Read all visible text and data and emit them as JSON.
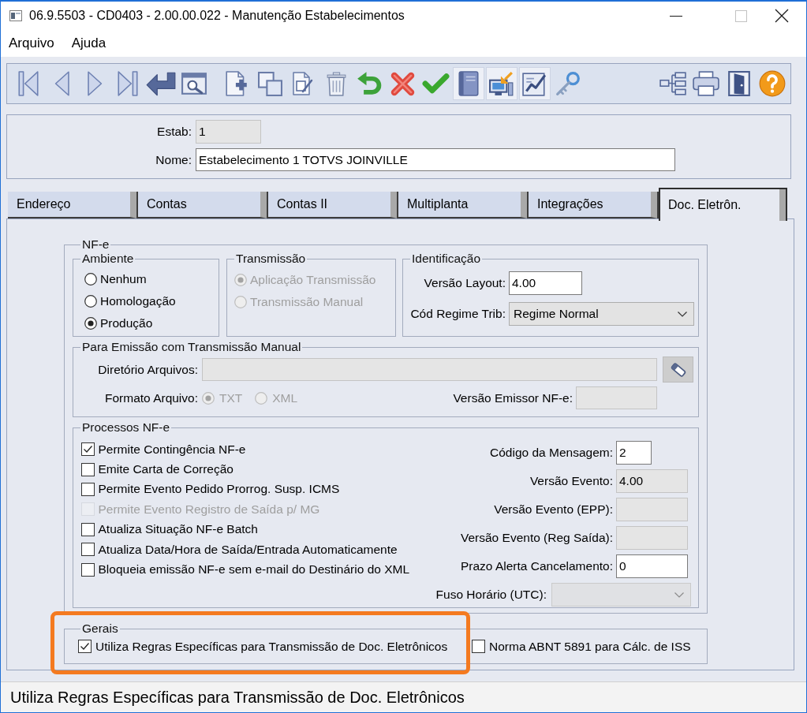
{
  "window": {
    "title": "06.9.5503 - CD0403 - 2.00.00.022 - Manutenção Estabelecimentos"
  },
  "menu": [
    {
      "label": "Arquivo"
    },
    {
      "label": "Ajuda"
    }
  ],
  "toolbar": {
    "left": [
      {
        "pressed": false
      },
      {
        "pressed": false
      },
      {
        "pressed": false
      },
      {
        "pressed": false
      },
      {
        "pressed": false
      },
      {
        "pressed": false
      },
      {
        "pressed": false
      },
      {
        "pressed": false
      },
      {
        "pressed": false
      },
      {
        "pressed": false
      },
      {
        "pressed": false
      },
      {
        "pressed": false
      },
      {
        "pressed": false
      },
      {
        "pressed": true
      },
      {
        "pressed": true
      },
      {
        "pressed": true
      },
      {
        "pressed": false
      }
    ],
    "right": [
      {
        "pressed": false
      },
      {
        "pressed": false
      },
      {
        "pressed": false
      },
      {
        "pressed": false
      }
    ]
  },
  "header": {
    "fields": [
      {
        "label": "Estab:",
        "value": "1",
        "disabled": true
      },
      {
        "label": "Nome:",
        "value": "Estabelecimento 1 TOTVS JOINVILLE",
        "disabled": false
      }
    ]
  },
  "tabs": [
    {
      "label": "Endereço",
      "selected": false
    },
    {
      "label": "Contas",
      "selected": false
    },
    {
      "label": "Contas II",
      "selected": false
    },
    {
      "label": "Multiplanta",
      "selected": false
    },
    {
      "label": "Integrações",
      "selected": false
    },
    {
      "label": "Doc. Eletrôn.",
      "selected": true
    }
  ],
  "nfe": {
    "legend": "NF-e",
    "ambiente": {
      "legend": "Ambiente",
      "options": [
        {
          "label": "Nenhum",
          "selected": false,
          "disabled": false
        },
        {
          "label": "Homologação",
          "selected": false,
          "disabled": false
        },
        {
          "label": "Produção",
          "selected": true,
          "disabled": false
        }
      ]
    },
    "transmissao": {
      "legend": "Transmissão",
      "options": [
        {
          "label": "Aplicação Transmissão",
          "selected": true,
          "disabled": true
        },
        {
          "label": "Transmissão Manual",
          "selected": false,
          "disabled": true
        }
      ]
    },
    "identificacao": {
      "legend": "Identificação",
      "fields": [
        {
          "kind": "input",
          "label": "Versão Layout:",
          "value": "4.00",
          "disabled": false
        },
        {
          "kind": "select",
          "label": "Cód Regime Trib:",
          "value": "Regime Normal",
          "disabled": false
        }
      ]
    },
    "emissao_manual": {
      "legend": "Para Emissão com Transmissão Manual",
      "diretorio": {
        "label": "Diretório Arquivos:",
        "disabled": true
      },
      "formato": {
        "label": "Formato Arquivo:",
        "options": [
          {
            "label": "TXT",
            "selected": true,
            "disabled": true
          },
          {
            "label": "XML",
            "selected": false,
            "disabled": true
          }
        ]
      },
      "versao_emissor": {
        "label": "Versão Emissor NF-e:",
        "disabled": true
      }
    },
    "processos": {
      "legend": "Processos NF-e",
      "checkboxes": [
        {
          "label": "Permite Contingência NF-e",
          "checked": true,
          "disabled": false
        },
        {
          "label": "Emite Carta de Correção",
          "checked": false,
          "disabled": false
        },
        {
          "label": "Permite Evento Pedido Prorrog. Susp. ICMS",
          "checked": false,
          "disabled": false
        },
        {
          "label": "Permite Evento Registro de Saída p/ MG",
          "checked": false,
          "disabled": true
        },
        {
          "label": "Atualiza Situação NF-e Batch",
          "checked": false,
          "disabled": false
        },
        {
          "label": "Atualiza Data/Hora de Saída/Entrada Automaticamente",
          "checked": false,
          "disabled": false
        },
        {
          "label": "Bloqueia emissão NF-e sem e-mail do Destinário do XML",
          "checked": false,
          "disabled": false
        }
      ],
      "fields": [
        {
          "kind": "input",
          "label": "Código da Mensagem:",
          "value": "2",
          "disabled": false
        },
        {
          "kind": "input",
          "label": "Versão Evento:",
          "value": "4.00",
          "disabled": true
        },
        {
          "kind": "input",
          "label": "Versão Evento (EPP):",
          "disabled": true
        },
        {
          "kind": "input",
          "label": "Versão Evento (Reg Saída):",
          "disabled": true
        },
        {
          "kind": "input",
          "label": "Prazo Alerta Cancelamento:",
          "value": "0",
          "disabled": false
        },
        {
          "kind": "select",
          "label": "Fuso Horário (UTC):",
          "disabled": true
        }
      ]
    }
  },
  "gerais": {
    "legend": "Gerais",
    "checkboxes": [
      {
        "label": "Utiliza Regras Específicas para Transmissão de Doc. Eletrônicos",
        "checked": true,
        "disabled": false
      },
      {
        "label": "Norma ABNT 5891 para Cálc. de ISS",
        "checked": false,
        "disabled": false
      }
    ]
  },
  "status_bar": {
    "text": "Utiliza Regras Específicas para Transmissão de Doc. Eletrônicos"
  }
}
